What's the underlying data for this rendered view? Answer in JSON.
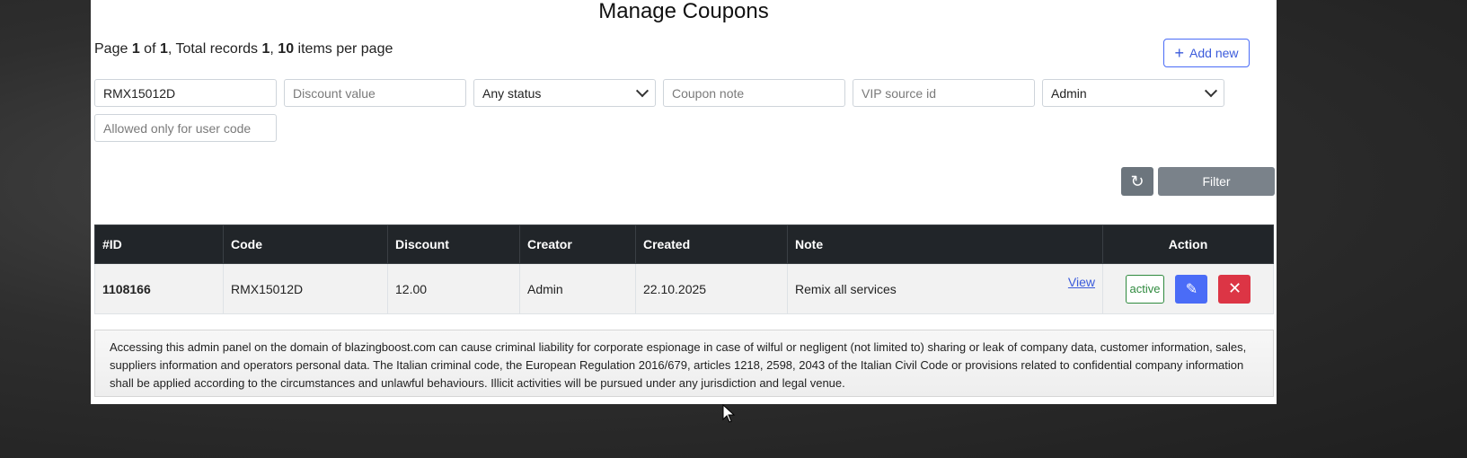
{
  "title": "Manage Coupons",
  "summary": {
    "page_prefix": "Page ",
    "page": "1",
    "of": " of ",
    "total_pages": "1",
    "records_prefix": ", Total records ",
    "records": "1",
    "sep": ", ",
    "per_page": "10",
    "per_page_suffix": " items per page"
  },
  "add_new_label": "Add new",
  "filters": {
    "code_value": "RMX15012D",
    "discount_placeholder": "Discount value",
    "status_selected": "Any status",
    "note_placeholder": "Coupon note",
    "vip_placeholder": "VIP source id",
    "creator_selected": "Admin",
    "user_code_placeholder": "Allowed only for user code"
  },
  "filter_label": "Filter",
  "table": {
    "headers": [
      "#ID",
      "Code",
      "Discount",
      "Creator",
      "Created",
      "Note",
      "Action"
    ],
    "rows": [
      {
        "id": "1108166",
        "code": "RMX15012D",
        "discount": "12.00",
        "creator": "Admin",
        "created": "22.10.2025",
        "note": "Remix all services",
        "view_label": "View",
        "status": "active"
      }
    ]
  },
  "notice": "Accessing this admin panel on the domain of blazingboost.com can cause criminal liability for corporate espionage in case of wilful or negligent (not limited to) sharing or leak of company data, customer information, sales, suppliers information and operators personal data. The Italian criminal code, the European Regulation 2016/679, articles 1218, 2598, 2043 of the Italian Civil Code or provisions related to confidential company information shall be applied according to the circumstances and unlawful behaviours. Illicit activities will be pursued under any jurisdiction and legal venue.",
  "colors": {
    "primary": "#4a6cf7",
    "danger": "#dc3545",
    "success": "#2f8a3e",
    "header_bg": "#212529"
  }
}
